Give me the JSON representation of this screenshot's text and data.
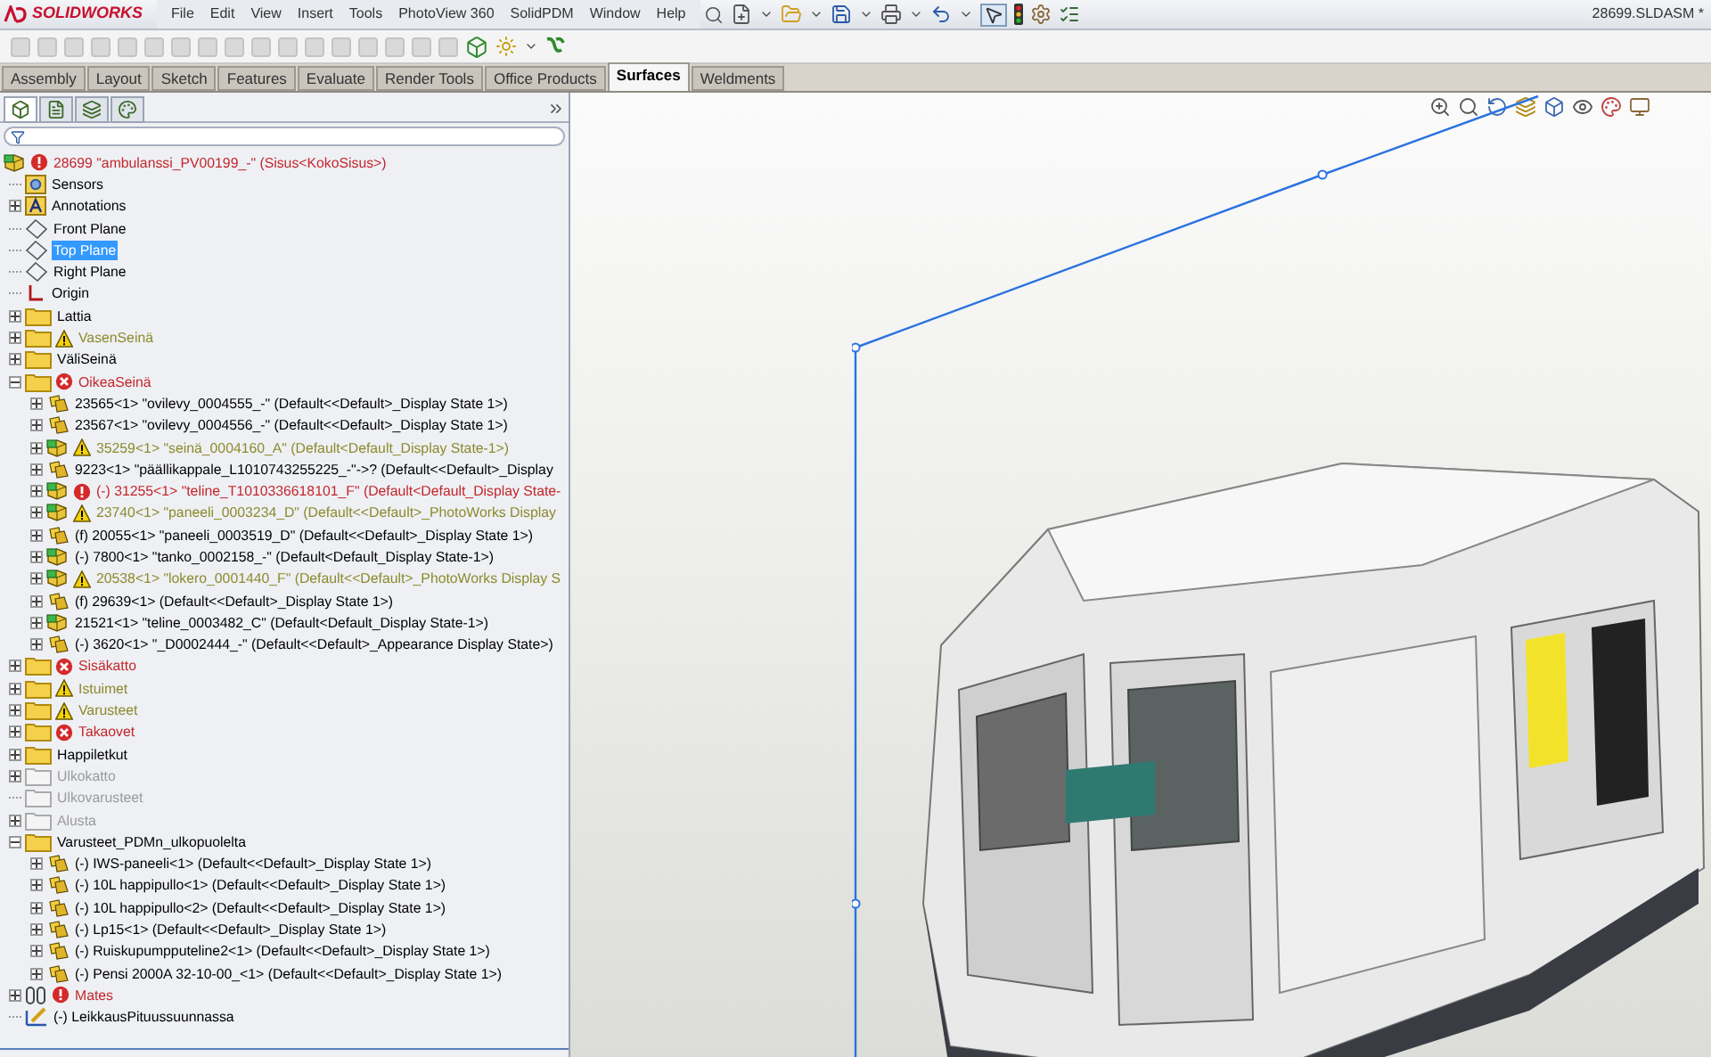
{
  "app": {
    "logo": "SOLIDWORKS",
    "document_title": "28699.SLDASM *"
  },
  "menu": [
    "File",
    "Edit",
    "View",
    "Insert",
    "Tools",
    "PhotoView 360",
    "SolidPDM",
    "Window",
    "Help"
  ],
  "tabs": [
    {
      "label": "Assembly",
      "selected": false
    },
    {
      "label": "Layout",
      "selected": false
    },
    {
      "label": "Sketch",
      "selected": false
    },
    {
      "label": "Features",
      "selected": false
    },
    {
      "label": "Evaluate",
      "selected": false
    },
    {
      "label": "Render Tools",
      "selected": false
    },
    {
      "label": "Office Products",
      "selected": false
    },
    {
      "label": "Surfaces",
      "selected": true
    },
    {
      "label": "Weldments",
      "selected": false
    }
  ],
  "panel_tabs": [
    {
      "kind": "tree",
      "selected": true
    },
    {
      "kind": "property",
      "selected": false
    },
    {
      "kind": "config",
      "selected": false
    },
    {
      "kind": "appearance",
      "selected": false
    }
  ],
  "tree": {
    "label": "28699 \"ambulanssi_PV00199_-\"  (Sisus<KokoSisus>)",
    "kind": "assembly",
    "warning": false,
    "error": false,
    "rebuild_error": true,
    "suppressed": false,
    "selected": false,
    "children": [
      {
        "label": "Sensors",
        "kind": "sensors",
        "warning": false,
        "error": false,
        "rebuild_error": false,
        "suppressed": false,
        "selected": false
      },
      {
        "label": "Annotations",
        "kind": "annotations",
        "warning": false,
        "error": false,
        "rebuild_error": false,
        "suppressed": false,
        "selected": false,
        "expanded": false
      },
      {
        "label": "Front Plane",
        "kind": "plane",
        "warning": false,
        "error": false,
        "rebuild_error": false,
        "suppressed": false,
        "selected": false
      },
      {
        "label": "Top Plane",
        "kind": "plane",
        "warning": false,
        "error": false,
        "rebuild_error": false,
        "suppressed": false,
        "selected": true
      },
      {
        "label": "Right Plane",
        "kind": "plane",
        "warning": false,
        "error": false,
        "rebuild_error": false,
        "suppressed": false,
        "selected": false
      },
      {
        "label": "Origin",
        "kind": "origin",
        "warning": false,
        "error": false,
        "rebuild_error": false,
        "suppressed": false,
        "selected": false
      },
      {
        "label": "Lattia",
        "kind": "folder",
        "warning": false,
        "error": false,
        "rebuild_error": false,
        "suppressed": false,
        "selected": false,
        "expanded": false
      },
      {
        "label": "VasenSeinä",
        "kind": "folder",
        "warning": true,
        "error": false,
        "rebuild_error": false,
        "suppressed": false,
        "selected": false,
        "expanded": false
      },
      {
        "label": "VäliSeinä",
        "kind": "folder",
        "warning": false,
        "error": false,
        "rebuild_error": false,
        "suppressed": false,
        "selected": false,
        "expanded": false
      },
      {
        "label": "OikeaSeinä",
        "kind": "folder",
        "warning": false,
        "error": true,
        "rebuild_error": false,
        "suppressed": false,
        "selected": false,
        "expanded": true,
        "children": [
          {
            "label": "23565<1> \"ovilevy_0004555_-\" (Default<<Default>_Display State 1>)",
            "kind": "part",
            "warning": false,
            "error": false,
            "rebuild_error": false,
            "suppressed": false,
            "selected": false,
            "expanded": false
          },
          {
            "label": "23567<1> \"ovilevy_0004556_-\" (Default<<Default>_Display State 1>)",
            "kind": "part",
            "warning": false,
            "error": false,
            "rebuild_error": false,
            "suppressed": false,
            "selected": false,
            "expanded": false
          },
          {
            "label": "35259<1> \"seinä_0004160_A\" (Default<Default_Display State-1>)",
            "kind": "subassembly",
            "warning": true,
            "error": false,
            "rebuild_error": false,
            "suppressed": false,
            "selected": false,
            "expanded": false
          },
          {
            "label": "9223<1> \"päällikappale_L1010743255225_-\"->? (Default<<Default>_Display",
            "kind": "part",
            "warning": false,
            "error": false,
            "rebuild_error": false,
            "suppressed": false,
            "selected": false,
            "expanded": false
          },
          {
            "label": "(-) 31255<1> \"teline_T1010336618101_F\" (Default<Default_Display State-",
            "kind": "subassembly",
            "warning": false,
            "error": false,
            "rebuild_error": true,
            "suppressed": false,
            "selected": false,
            "expanded": false
          },
          {
            "label": "23740<1> \"paneeli_0003234_D\" (Default<<Default>_PhotoWorks Display",
            "kind": "subassembly",
            "warning": true,
            "error": false,
            "rebuild_error": false,
            "suppressed": false,
            "selected": false,
            "expanded": false
          },
          {
            "label": "(f) 20055<1> \"paneeli_0003519_D\" (Default<<Default>_Display State 1>)",
            "kind": "part",
            "warning": false,
            "error": false,
            "rebuild_error": false,
            "suppressed": false,
            "selected": false,
            "expanded": false
          },
          {
            "label": "(-) 7800<1> \"tanko_0002158_-\" (Default<Default_Display State-1>)",
            "kind": "subassembly",
            "warning": false,
            "error": false,
            "rebuild_error": false,
            "suppressed": false,
            "selected": false,
            "expanded": false
          },
          {
            "label": "20538<1> \"lokero_0001440_F\" (Default<<Default>_PhotoWorks Display S",
            "kind": "subassembly",
            "warning": true,
            "error": false,
            "rebuild_error": false,
            "suppressed": false,
            "selected": false,
            "expanded": false
          },
          {
            "label": "(f) 29639<1> (Default<<Default>_Display State 1>)",
            "kind": "part",
            "warning": false,
            "error": false,
            "rebuild_error": false,
            "suppressed": false,
            "selected": false,
            "expanded": false
          },
          {
            "label": "21521<1> \"teline_0003482_C\" (Default<Default_Display State-1>)",
            "kind": "subassembly",
            "warning": false,
            "error": false,
            "rebuild_error": false,
            "suppressed": false,
            "selected": false,
            "expanded": false
          },
          {
            "label": "(-) 3620<1> \"_D0002444_-\" (Default<<Default>_Appearance Display State>)",
            "kind": "part",
            "warning": false,
            "error": false,
            "rebuild_error": false,
            "suppressed": false,
            "selected": false,
            "expanded": false
          }
        ]
      },
      {
        "label": "Sisäkatto",
        "kind": "folder",
        "warning": false,
        "error": true,
        "rebuild_error": false,
        "suppressed": false,
        "selected": false,
        "expanded": false
      },
      {
        "label": "Istuimet",
        "kind": "folder",
        "warning": true,
        "error": false,
        "rebuild_error": false,
        "suppressed": false,
        "selected": false,
        "expanded": false
      },
      {
        "label": "Varusteet",
        "kind": "folder",
        "warning": true,
        "error": false,
        "rebuild_error": false,
        "suppressed": false,
        "selected": false,
        "expanded": false
      },
      {
        "label": "Takaovet",
        "kind": "folder",
        "warning": false,
        "error": true,
        "rebuild_error": false,
        "suppressed": false,
        "selected": false,
        "expanded": false
      },
      {
        "label": "Happiletkut",
        "kind": "folder",
        "warning": false,
        "error": false,
        "rebuild_error": false,
        "suppressed": false,
        "selected": false,
        "expanded": false
      },
      {
        "label": "Ulkokatto",
        "kind": "folder",
        "warning": false,
        "error": false,
        "rebuild_error": false,
        "suppressed": true,
        "selected": false,
        "expanded": false
      },
      {
        "label": "Ulkovarusteet",
        "kind": "folder",
        "warning": false,
        "error": false,
        "rebuild_error": false,
        "suppressed": true,
        "selected": false
      },
      {
        "label": "Alusta",
        "kind": "folder",
        "warning": false,
        "error": false,
        "rebuild_error": false,
        "suppressed": true,
        "selected": false,
        "expanded": false
      },
      {
        "label": "Varusteet_PDMn_ulkopuolelta",
        "kind": "folder",
        "warning": false,
        "error": false,
        "rebuild_error": false,
        "suppressed": false,
        "selected": false,
        "expanded": true,
        "children": [
          {
            "label": "(-) IWS-paneeli<1> (Default<<Default>_Display State 1>)",
            "kind": "part",
            "warning": false,
            "error": false,
            "rebuild_error": false,
            "suppressed": false,
            "selected": false,
            "expanded": false
          },
          {
            "label": "(-) 10L happipullo<1> (Default<<Default>_Display State 1>)",
            "kind": "part",
            "warning": false,
            "error": false,
            "rebuild_error": false,
            "suppressed": false,
            "selected": false,
            "expanded": false
          },
          {
            "label": "(-) 10L happipullo<2> (Default<<Default>_Display State 1>)",
            "kind": "part",
            "warning": false,
            "error": false,
            "rebuild_error": false,
            "suppressed": false,
            "selected": false,
            "expanded": false
          },
          {
            "label": "(-) Lp15<1> (Default<<Default>_Display State 1>)",
            "kind": "part",
            "warning": false,
            "error": false,
            "rebuild_error": false,
            "suppressed": false,
            "selected": false,
            "expanded": false
          },
          {
            "label": "(-) Ruiskupumpputeline2<1> (Default<<Default>_Display State 1>)",
            "kind": "part",
            "warning": false,
            "error": false,
            "rebuild_error": false,
            "suppressed": false,
            "selected": false,
            "expanded": false
          },
          {
            "label": "(-) Pensi 2000A 32-10-00_<1> (Default<<Default>_Display State 1>)",
            "kind": "part",
            "warning": false,
            "error": false,
            "rebuild_error": false,
            "suppressed": false,
            "selected": false,
            "expanded": false
          }
        ]
      },
      {
        "label": "Mates",
        "kind": "mates",
        "warning": false,
        "error": false,
        "rebuild_error": true,
        "suppressed": false,
        "selected": false,
        "expanded": false
      },
      {
        "label": "(-) LeikkausPituussuunnassa",
        "kind": "sketch",
        "warning": false,
        "error": false,
        "rebuild_error": false,
        "suppressed": false,
        "selected": false
      }
    ]
  }
}
